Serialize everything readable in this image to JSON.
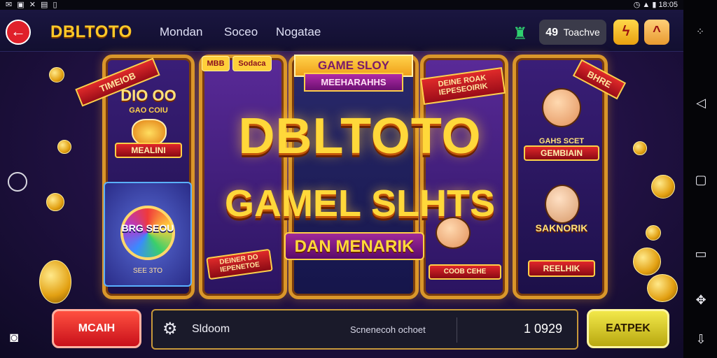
{
  "status": {
    "left": "✉ ▣ ✕ ▤ ▯",
    "right": "◷ ▲ ▮ 18:05"
  },
  "topbar": {
    "logo": "DBLTOTO",
    "nav": [
      "Mondan",
      "Soceo",
      "Nogatae"
    ],
    "balance_value": "49",
    "balance_label": "Toachve",
    "icons": [
      "back-arrow-icon",
      "trophy-icon",
      "bolt-icon",
      "chevron-up-icon"
    ]
  },
  "side": {
    "right_icons": [
      "grid-icon",
      "back-triangle-icon",
      "square-icon",
      "recent-apps-icon",
      "puzzle-icon",
      "download-icon"
    ],
    "left_icons": [
      "home-circle-icon",
      "camera-icon"
    ]
  },
  "stage": {
    "tags": [
      "MBB",
      "Sodaca"
    ],
    "top_banner": "GAME SLOY",
    "top_banner_sub": "MEEHARAHHS",
    "mid_ribbon": "DEINE ROAK IEPESEOIRIK",
    "left_ribbon": "TIMEIOB",
    "left_title": "DIO OO",
    "left_sub": "GAO COIU",
    "left_banner": "MEALINI",
    "wheel_label": "BRG SEOU",
    "left_box_caption": "SEE 3TO",
    "center_left_banner": "DEINER DO IEPENETOE",
    "headline_1": "DBLTOTO",
    "headline_2": "GAMEL SLHTS",
    "headline_3": "DAN MENARIK",
    "right_ribbon": "BHRE",
    "right_top_caption": "GAHS SCET",
    "right_top_banner": "GEMBIAIN",
    "right_mid_caption": "SAKNORIK",
    "right_bottom_banner": "REELHIK",
    "center_right_banner": "COOB CEHE"
  },
  "bottom": {
    "left_button": "MCAIH",
    "panel_label": "Sldoom",
    "panel_mid": "Scnenecoh ochoet",
    "panel_value": "1 0929",
    "right_button": "EATPEK"
  },
  "colors": {
    "accent": "#ffc928",
    "bg": "#241248",
    "red": "#e0202a",
    "yellow": "#f2e84a"
  }
}
